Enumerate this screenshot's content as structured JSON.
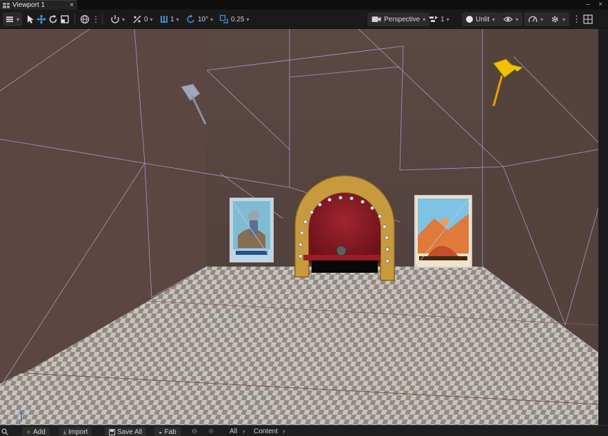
{
  "tabs": [
    {
      "label": "Viewport 1",
      "close_icon": "×"
    }
  ],
  "toolbar": {
    "grid_snap_value": "0",
    "rotation_value": "1",
    "angle_value": "10°",
    "scale_value": "0.25",
    "view_mode": "Perspective",
    "camera_speed": "1",
    "lit_mode": "Unlit"
  },
  "bottom": {
    "add_label": "Add",
    "import_label": "Import",
    "saveall_label": "Save All",
    "fab_label": "Fab",
    "path_root": "All",
    "path_folder": "Content"
  },
  "colors": {
    "accent_blue": "#3d8fd6",
    "wall": "#5d4a44",
    "floor_light": "#c9c3bb",
    "floor_dark": "#8f8a84",
    "arch_gold": "#c89a3e",
    "arch_red": "#8c1a22",
    "spotlight_yellow": "#f2c200"
  }
}
